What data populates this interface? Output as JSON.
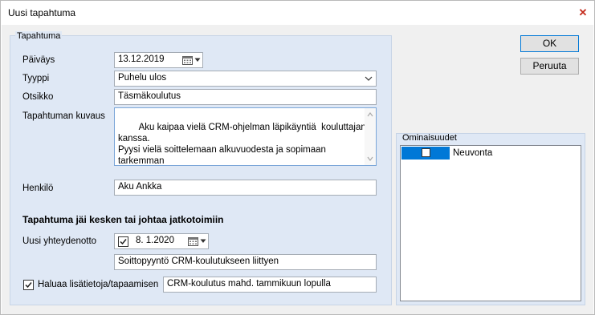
{
  "window": {
    "title": "Uusi tapahtuma",
    "close_glyph": "✕"
  },
  "buttons": {
    "ok": "OK",
    "cancel": "Peruuta"
  },
  "event_group": {
    "title": "Tapahtuma",
    "date_label": "Päiväys",
    "date_value": "13.12.2019",
    "type_label": "Tyyppi",
    "type_value": "Puhelu ulos",
    "subject_label": "Otsikko",
    "subject_value": "Täsmäkoulutus",
    "description_label": "Tapahtuman kuvaus",
    "description_value": "Aku kaipaa vielä CRM-ohjelman läpikäyntiä  kouluttajan kanssa.\nPyysi vielä soittelemaan alkuvuodesta ja sopimaan tarkemman\najan.",
    "person_label": "Henkilö",
    "person_value": "Aku Ankka"
  },
  "followup": {
    "heading": "Tapahtuma jäi kesken tai johtaa jatkotoimiin",
    "new_contact_label": "Uusi yhteydenotto",
    "new_contact_checked": true,
    "new_contact_date": "8.  1.2020",
    "new_contact_text": "Soittopyyntö CRM-koulutukseen liittyen",
    "more_info_label": "Haluaa lisätietoja/tapaamisen",
    "more_info_checked": true,
    "more_info_text": "CRM-koulutus mahd. tammikuun lopulla"
  },
  "properties": {
    "title": "Ominaisuudet",
    "items": [
      {
        "label": "Neuvonta",
        "checked": false,
        "selected": true
      }
    ]
  },
  "colors": {
    "accent": "#0078d7",
    "group_bg": "#dfe8f5",
    "dialog_bg": "#f0f0f0",
    "close_red": "#c42b1c"
  }
}
